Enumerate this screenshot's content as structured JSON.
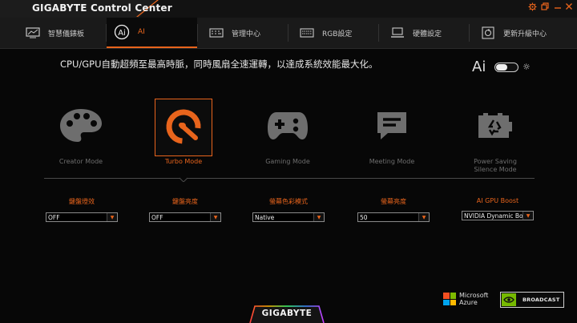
{
  "window": {
    "title": "GIGABYTE Control Center",
    "buttons": [
      "settings",
      "restore",
      "minimize",
      "close"
    ]
  },
  "nav": {
    "tabs": [
      {
        "label": "智慧儀錶板",
        "icon": "dashboard-icon",
        "active": false
      },
      {
        "label": "AI",
        "icon": "ai-icon",
        "active": true
      },
      {
        "label": "管理中心",
        "icon": "keyboard-manage-icon",
        "active": false
      },
      {
        "label": "RGB設定",
        "icon": "keyboard-rgb-icon",
        "active": false
      },
      {
        "label": "硬體設定",
        "icon": "laptop-icon",
        "active": false
      },
      {
        "label": "更新升級中心",
        "icon": "update-icon",
        "active": false
      }
    ]
  },
  "main": {
    "description": "CPU/GPU自動超頻至最高時脈，同時風扇全速運轉，以達成系統效能最大化。",
    "ai_logo": "Ai",
    "ai_toggle_on": false
  },
  "modes": [
    {
      "label": "Creator Mode",
      "icon": "palette-icon",
      "active": false
    },
    {
      "label": "Turbo Mode",
      "icon": "speedometer-icon",
      "active": true
    },
    {
      "label": "Gaming Mode",
      "icon": "gamepad-icon",
      "active": false
    },
    {
      "label": "Meeting Mode",
      "icon": "chat-icon",
      "active": false
    },
    {
      "label": "Power Saving\nSilence Mode",
      "icon": "battery-recycle-icon",
      "active": false
    }
  ],
  "settings": [
    {
      "label": "鍵盤燈效",
      "value": "OFF"
    },
    {
      "label": "鍵盤亮度",
      "value": "OFF"
    },
    {
      "label": "螢幕色彩模式",
      "value": "Native"
    },
    {
      "label": "螢幕亮度",
      "value": "50"
    },
    {
      "label": "AI GPU Boost",
      "value": "NVIDIA Dynamic Bo"
    }
  ],
  "footer": {
    "microsoft_line1": "Microsoft",
    "microsoft_line2": "Azure",
    "nvidia_label": "BROADCAST",
    "brand": "GIGABYTE"
  },
  "colors": {
    "accent": "#e8641c",
    "background": "#070707",
    "inactive": "#6e6e6e"
  }
}
